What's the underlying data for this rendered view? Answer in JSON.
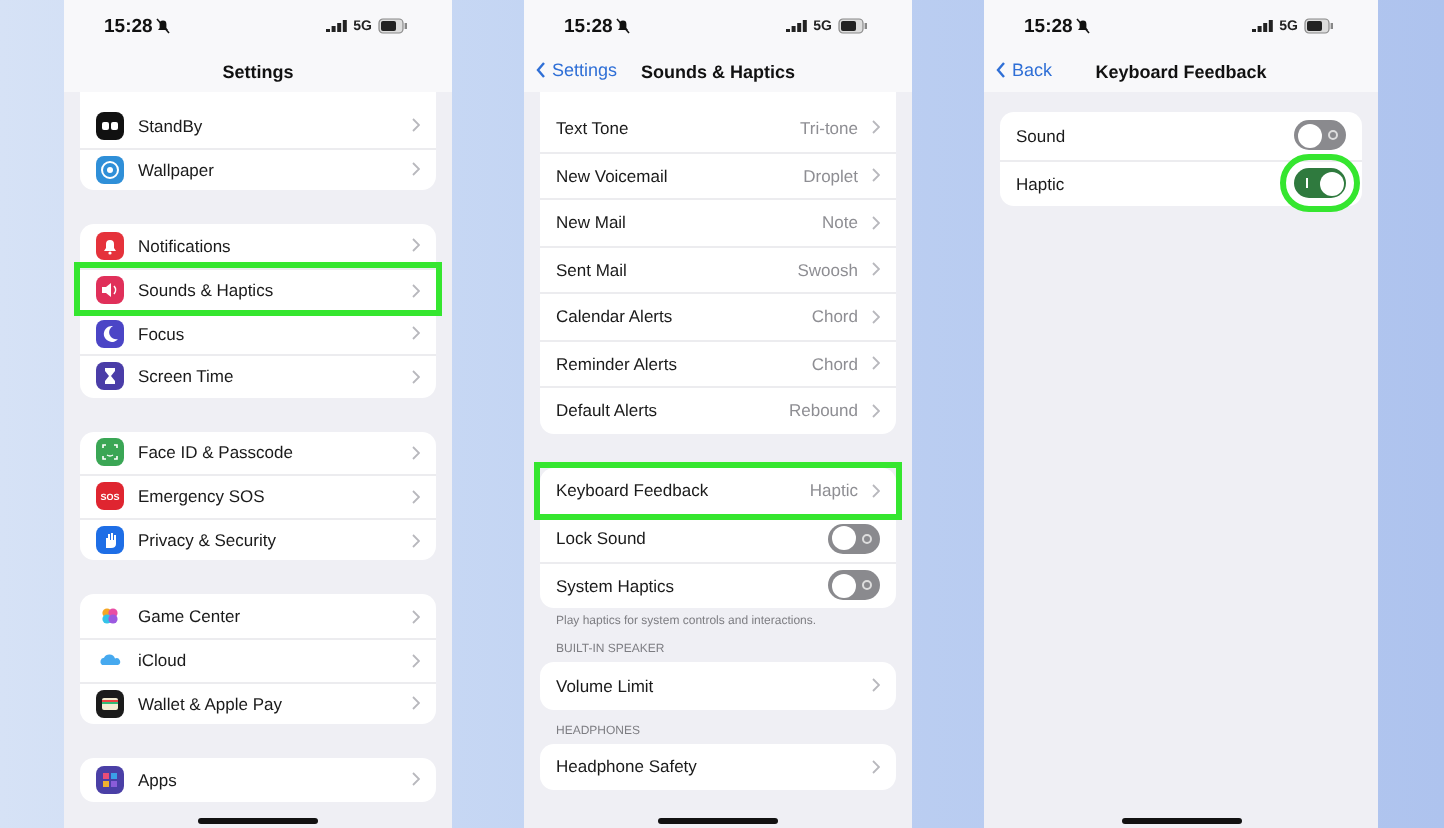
{
  "screens": [
    {
      "status": {
        "time": "15:28",
        "network": "5G"
      },
      "nav": {
        "title": "Settings"
      },
      "top_sliver": true,
      "groups": [
        {
          "rows": [
            {
              "label": "StandBy",
              "kind": "link",
              "color": "#111111",
              "highlighted": false
            },
            {
              "label": "Wallpaper",
              "kind": "link",
              "color": "#2f8fd8",
              "highlighted": false
            }
          ]
        },
        {
          "rows": [
            {
              "label": "Notifications",
              "kind": "link",
              "color": "#e5323b",
              "highlighted": false
            },
            {
              "label": "Sounds & Haptics",
              "kind": "link",
              "color": "#e0305a",
              "highlighted": true
            },
            {
              "label": "Focus",
              "kind": "link",
              "color": "#4b45c6",
              "highlighted": false
            },
            {
              "label": "Screen Time",
              "kind": "link",
              "color": "#4a3da8",
              "highlighted": false
            }
          ]
        },
        {
          "rows": [
            {
              "label": "Face ID & Passcode",
              "kind": "link",
              "color": "#3aa655",
              "highlighted": false
            },
            {
              "label": "Emergency SOS",
              "kind": "link",
              "color": "#df2530",
              "icon_text": "SOS",
              "highlighted": false
            },
            {
              "label": "Privacy & Security",
              "kind": "link",
              "color": "#1e6ee6",
              "highlighted": false
            }
          ]
        },
        {
          "rows": [
            {
              "label": "Game Center",
              "kind": "link",
              "color": "#ffffff",
              "highlighted": false
            },
            {
              "label": "iCloud",
              "kind": "link",
              "color": "#ffffff",
              "highlighted": false
            },
            {
              "label": "Wallet & Apple Pay",
              "kind": "link",
              "color": "#1b1b1b",
              "highlighted": false
            }
          ]
        },
        {
          "rows": [
            {
              "label": "Apps",
              "kind": "link",
              "color": "#4a3fa6",
              "highlighted": false
            }
          ]
        }
      ]
    },
    {
      "status": {
        "time": "15:28",
        "network": "5G"
      },
      "nav": {
        "back": "Settings",
        "title": "Sounds & Haptics"
      },
      "top_sliver": true,
      "groups": [
        {
          "rows": [
            {
              "label": "Text Tone",
              "kind": "link",
              "value": "Tri-tone",
              "highlighted": false
            },
            {
              "label": "New Voicemail",
              "kind": "link",
              "value": "Droplet",
              "highlighted": false
            },
            {
              "label": "New Mail",
              "kind": "link",
              "value": "Note",
              "highlighted": false
            },
            {
              "label": "Sent Mail",
              "kind": "link",
              "value": "Swoosh",
              "highlighted": false
            },
            {
              "label": "Calendar Alerts",
              "kind": "link",
              "value": "Chord",
              "highlighted": false
            },
            {
              "label": "Reminder Alerts",
              "kind": "link",
              "value": "Chord",
              "highlighted": false
            },
            {
              "label": "Default Alerts",
              "kind": "link",
              "value": "Rebound",
              "highlighted": false
            }
          ]
        },
        {
          "rows": [
            {
              "label": "Keyboard Feedback",
              "kind": "link",
              "value": "Haptic",
              "highlighted": true
            },
            {
              "label": "Lock Sound",
              "kind": "toggle",
              "on": false,
              "highlighted": false
            },
            {
              "label": "System Haptics",
              "kind": "toggle",
              "on": false,
              "highlighted": false
            }
          ],
          "footer": "Play haptics for system controls and interactions."
        },
        {
          "header": "BUILT-IN SPEAKER",
          "rows": [
            {
              "label": "Volume Limit",
              "kind": "link",
              "highlighted": false
            }
          ]
        },
        {
          "header": "HEADPHONES",
          "rows": [
            {
              "label": "Headphone Safety",
              "kind": "link",
              "highlighted": false
            }
          ]
        }
      ]
    },
    {
      "status": {
        "time": "15:28",
        "network": "5G"
      },
      "nav": {
        "back": "Back",
        "title": "Keyboard Feedback"
      },
      "top_sliver": false,
      "groups": [
        {
          "rows": [
            {
              "label": "Sound",
              "kind": "toggle",
              "on": false,
              "highlighted": false
            },
            {
              "label": "Haptic",
              "kind": "toggle",
              "on": true,
              "highlighted": true
            }
          ]
        }
      ]
    }
  ]
}
